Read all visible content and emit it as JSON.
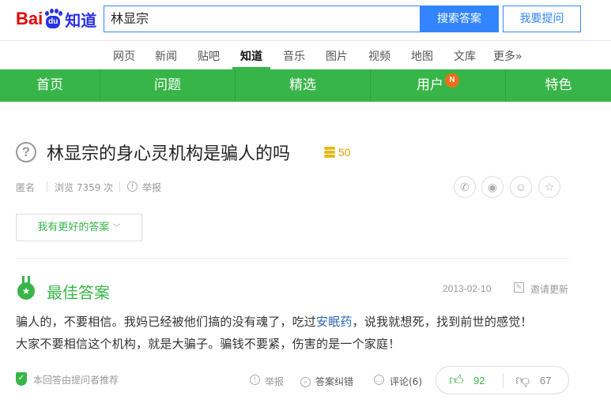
{
  "header": {
    "logo_bai": "Bai",
    "logo_du": "du",
    "logo_zhidao": "知道",
    "search_value": "林显宗",
    "search_button": "搜索答案",
    "ask_button": "我要提问"
  },
  "catnav": {
    "items": [
      "网页",
      "新闻",
      "贴吧",
      "知道",
      "音乐",
      "图片",
      "视频",
      "地图",
      "文库",
      "更多»"
    ],
    "active": "知道"
  },
  "greennav": {
    "items": [
      "首页",
      "问题",
      "精选",
      "用户",
      "特色"
    ],
    "badge": "N"
  },
  "question": {
    "title": "林显宗的身心灵机构是骗人的吗",
    "reward": "50",
    "asker": "匿名",
    "views": "浏览 7359 次",
    "report": "举报",
    "better_answer_button": "我有更好的答案"
  },
  "share_icons": [
    "wechat-icon",
    "weibo-icon",
    "qq-icon",
    "star-icon"
  ],
  "best_answer": {
    "title": "最佳答案",
    "date": "2013-02-10",
    "invite_update": "邀请更新",
    "text_before_link": "骗人的，不要相信。我妈已经被他们搞的没有魂了，吃过",
    "link_text": "安眠药",
    "text_after_link": "，说我就想死，找到前世的感觉！",
    "line2": "大家不要相信这个机构，就是大骗子。骗钱不要紧，伤害的是一个家庭！",
    "recommended_note": "本回答由提问者推荐",
    "report": "举报",
    "correct": "答案纠错",
    "comments": "评论(6)",
    "upvotes": "92",
    "downvotes": "67"
  },
  "colors": {
    "green": "#38b548",
    "blue": "#3385ff",
    "red": "#e10601",
    "badge_orange": "#f46c1a"
  }
}
